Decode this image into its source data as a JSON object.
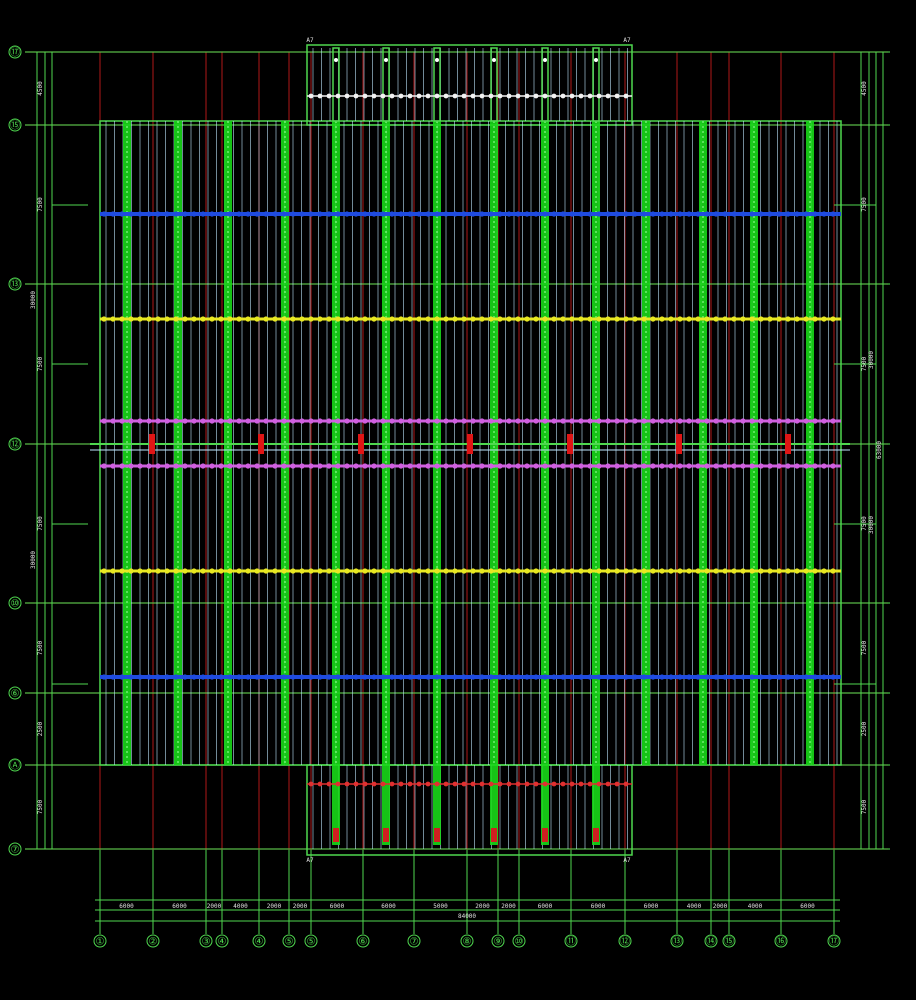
{
  "drawing": {
    "background": "#000000",
    "colors": {
      "grid_green": "#4fd84f",
      "thin_cyan": "#bfe8ff",
      "axis_red": "#b01818",
      "beam_green": "#18d818",
      "purlin_blue": "#1f4be0",
      "purlin_yellow": "#e8e822",
      "purlin_magenta": "#d060e0",
      "brace_red": "#e01515",
      "top_white": "#f2f2f2",
      "bottom_red": "#e03030"
    },
    "row_axes": [
      {
        "id": "ax-r1",
        "label": "⑰"
      },
      {
        "id": "ax-r2",
        "label": "⑮"
      },
      {
        "id": "ax-r3",
        "label": "⑬"
      },
      {
        "id": "ax-r4",
        "label": "⑫"
      },
      {
        "id": "ax-r5",
        "label": "⑩"
      },
      {
        "id": "ax-r6",
        "label": "⑥"
      },
      {
        "id": "ax-r7",
        "label": "Ⓐ"
      },
      {
        "id": "ax-r8",
        "label": "⑦"
      }
    ],
    "column_axes": [
      {
        "id": "ax-c1",
        "label": "①"
      },
      {
        "id": "ax-c2",
        "label": "②"
      },
      {
        "id": "ax-c3",
        "label": "③"
      },
      {
        "id": "ax-c4",
        "label": "④"
      },
      {
        "id": "ax-c5",
        "label": "④"
      },
      {
        "id": "ax-c6",
        "label": "⑤"
      },
      {
        "id": "ax-c7",
        "label": "⑤"
      },
      {
        "id": "ax-c8",
        "label": "⑥"
      },
      {
        "id": "ax-c9",
        "label": "⑦"
      },
      {
        "id": "ax-c10",
        "label": "⑧"
      },
      {
        "id": "ax-c11",
        "label": "⑨"
      },
      {
        "id": "ax-c12",
        "label": "⑩"
      },
      {
        "id": "ax-c13",
        "label": "⑪"
      },
      {
        "id": "ax-c14",
        "label": "⑫"
      },
      {
        "id": "ax-c15",
        "label": "⑬"
      },
      {
        "id": "ax-c16",
        "label": "⑭"
      },
      {
        "id": "ax-c17",
        "label": "⑮"
      },
      {
        "id": "ax-c18",
        "label": "⑯"
      },
      {
        "id": "ax-c19",
        "label": "⑰"
      }
    ],
    "bottom_dims": [
      "6000",
      "6000",
      "2000",
      "4000",
      "2000",
      "2000",
      "6000",
      "6000",
      "5000",
      "2000",
      "2000",
      "6000",
      "6000",
      "6000",
      "4000",
      "2000",
      "4000",
      "6000",
      "6000"
    ],
    "left_dims": [
      "4500",
      "7500",
      "7500",
      "7500",
      "7500",
      "2500",
      "7500",
      "2500"
    ],
    "right_dims": [
      "4500",
      "7500",
      "7500",
      "7500",
      "7500",
      "2500",
      "7500",
      "2500"
    ],
    "left_totals": [
      "30000",
      "30000"
    ],
    "right_totals": [
      "30000",
      "30000"
    ],
    "right_grand_total": "63000",
    "bottom_total": "84000",
    "notch_marks": [
      "A7",
      "A7",
      "A7",
      "A7"
    ]
  }
}
